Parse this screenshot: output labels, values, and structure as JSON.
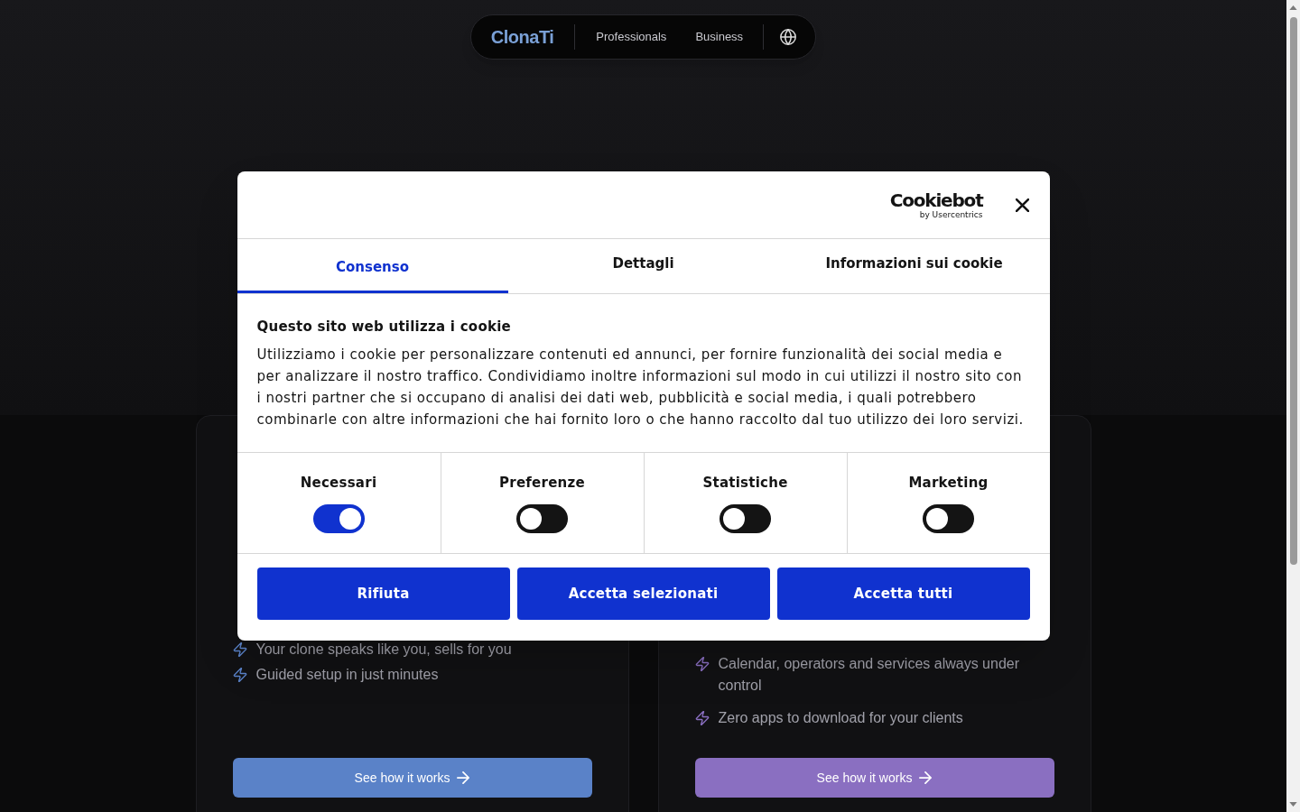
{
  "nav": {
    "logo": "ClonaTi",
    "links": [
      {
        "label": "Professionals"
      },
      {
        "label": "Business"
      }
    ]
  },
  "cards": [
    {
      "color": "#5a82c8",
      "features": [
        "Your clone speaks like you, sells for you",
        "Guided setup in just minutes"
      ],
      "button": "See how it works"
    },
    {
      "color": "#8a6fc1",
      "features": [
        "Calendar, operators and services always under control",
        "Zero apps to download for your clients"
      ],
      "button": "See how it works"
    }
  ],
  "cookie_dialog": {
    "logo": {
      "name": "Cookiebot",
      "tagline": "by Usercentrics"
    },
    "tabs": [
      {
        "label": "Consenso",
        "selected": true
      },
      {
        "label": "Dettagli",
        "selected": false
      },
      {
        "label": "Informazioni sui cookie",
        "selected": false
      }
    ],
    "heading": "Questo sito web utilizza i cookie",
    "text": "Utilizziamo i cookie per personalizzare contenuti ed annunci, per fornire funzionalità dei social media e per analizzare il nostro traffico. Condividiamo inoltre informazioni sul modo in cui utilizzi il nostro sito con i nostri partner che si occupano di analisi dei dati web, pubblicità e social media, i quali potrebbero combinarle con altre informazioni che hai fornito loro o che hanno raccolto dal tuo utilizzo dei loro servizi.",
    "categories": [
      {
        "label": "Necessari",
        "on": true
      },
      {
        "label": "Preferenze",
        "on": false
      },
      {
        "label": "Statistiche",
        "on": false
      },
      {
        "label": "Marketing",
        "on": false
      }
    ],
    "buttons": [
      "Rifiuta",
      "Accetta selezionati",
      "Accetta tutti"
    ]
  }
}
